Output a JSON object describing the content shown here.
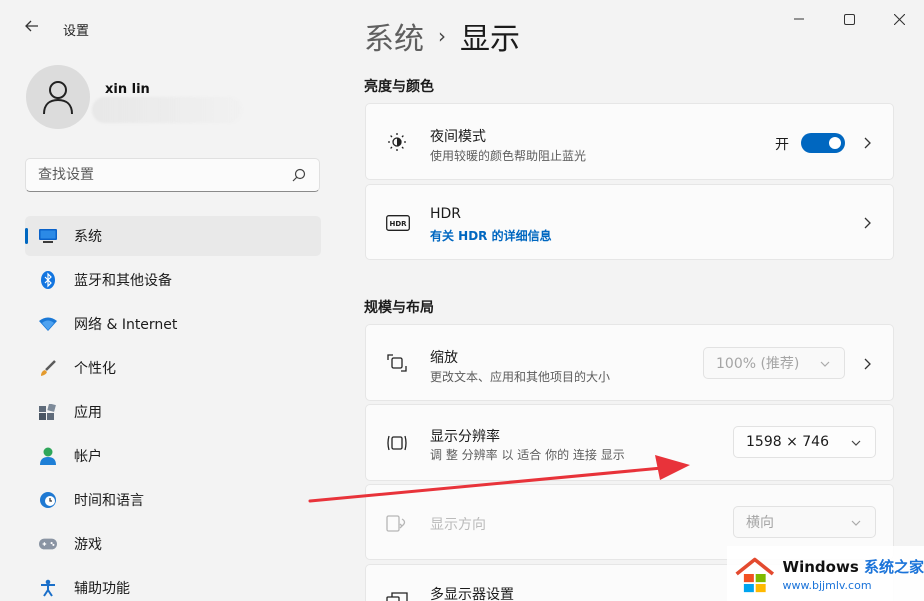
{
  "window": {
    "back_icon": "back-arrow-icon",
    "app_title": "设置",
    "controls": [
      "minimize-icon",
      "maximize-icon",
      "close-icon"
    ]
  },
  "user": {
    "name": "xin lin",
    "avatar_icon": "person-icon"
  },
  "search": {
    "placeholder": "查找设置",
    "icon": "search-icon"
  },
  "sidebar": {
    "items": [
      {
        "label": "系统",
        "icon": "monitor-icon",
        "active": true
      },
      {
        "label": "蓝牙和其他设备",
        "icon": "bluetooth-icon"
      },
      {
        "label": "网络 & Internet",
        "icon": "wifi-icon"
      },
      {
        "label": "个性化",
        "icon": "brush-icon"
      },
      {
        "label": "应用",
        "icon": "apps-icon"
      },
      {
        "label": "帐户",
        "icon": "account-icon"
      },
      {
        "label": "时间和语言",
        "icon": "globe-clock-icon"
      },
      {
        "label": "游戏",
        "icon": "gamepad-icon"
      },
      {
        "label": "辅助功能",
        "icon": "accessibility-icon"
      }
    ]
  },
  "breadcrumb": {
    "parent": "系统",
    "separator": "›",
    "current": "显示"
  },
  "sections": {
    "brightness_color": "亮度与颜色",
    "scale_layout": "规模与布局"
  },
  "cards": {
    "night_light": {
      "title": "夜间模式",
      "subtitle": "使用较暖的颜色帮助阻止蓝光",
      "toggle_label": "开",
      "toggle_on": true,
      "icon": "brightness-icon"
    },
    "hdr": {
      "title": "HDR",
      "link": "有关 HDR 的详细信息",
      "icon": "hdr-icon"
    },
    "scale": {
      "title": "缩放",
      "subtitle": "更改文本、应用和其他项目的大小",
      "value": "100% (推荐)",
      "icon": "scale-icon"
    },
    "resolution": {
      "title": "显示分辨率",
      "subtitle": "调 整 分辨率 以 适合 你的 连接 显示",
      "value": "1598 × 746",
      "icon": "resolution-icon"
    },
    "orientation": {
      "title": "显示方向",
      "value": "横向",
      "icon": "orientation-icon"
    },
    "multi_display": {
      "title": "多显示器设置",
      "icon": "multi-display-icon"
    }
  },
  "colors": {
    "accent": "#0067c0",
    "annotation_arrow": "#e8333a"
  },
  "watermark": {
    "brand": "Windows",
    "brand_cn": "系统之家",
    "url": "www.bjjmlv.com"
  }
}
